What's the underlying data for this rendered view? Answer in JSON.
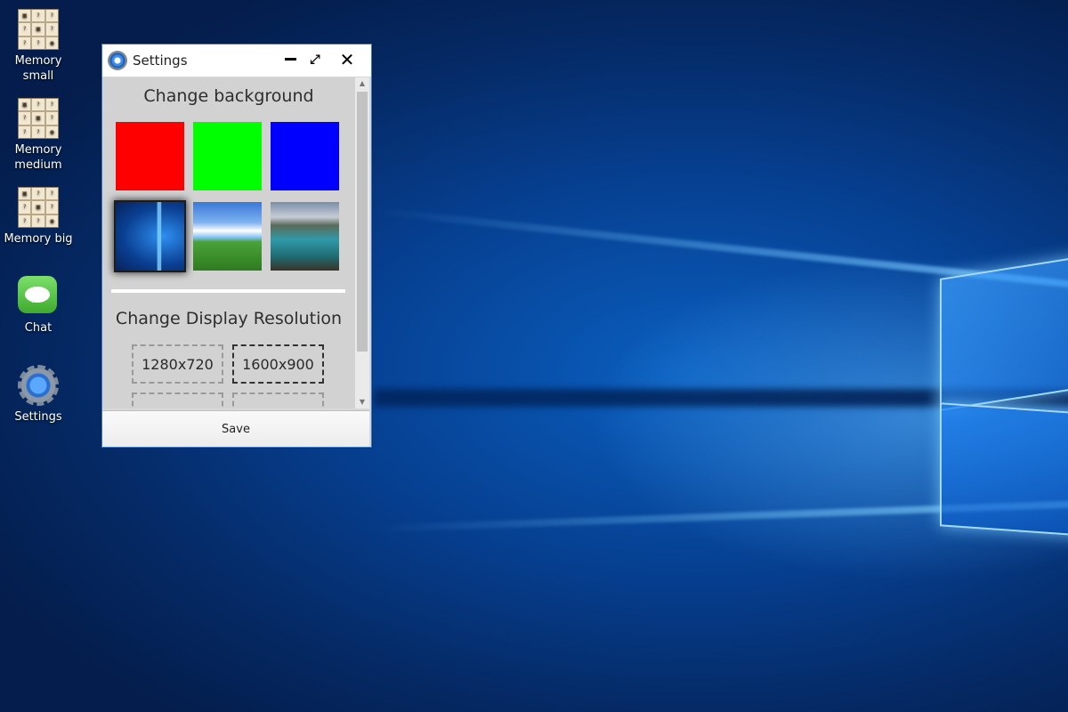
{
  "desktop": {
    "icons": [
      {
        "label": "Memory small",
        "icon": "memory-game-icon"
      },
      {
        "label": "Memory medium",
        "icon": "memory-game-icon"
      },
      {
        "label": "Memory big",
        "icon": "memory-game-icon"
      },
      {
        "label": "Chat",
        "icon": "chat-bubble-icon"
      },
      {
        "label": "Settings",
        "icon": "gear-icon"
      }
    ]
  },
  "window": {
    "title": "Settings",
    "buttons": {
      "minimize": "minimize-icon",
      "maximize": "maximize-icon",
      "close": "✕"
    },
    "background_section": {
      "title": "Change background",
      "options": [
        {
          "name": "red",
          "color": "#ff0000"
        },
        {
          "name": "green",
          "color": "#00ff00"
        },
        {
          "name": "blue",
          "color": "#0000ff"
        },
        {
          "name": "windows-10-wallpaper",
          "selected": true
        },
        {
          "name": "bliss-hill-wallpaper"
        },
        {
          "name": "mountain-lake-wallpaper"
        }
      ]
    },
    "resolution_section": {
      "title": "Change Display Resolution",
      "options": [
        {
          "label": "1280x720",
          "selected": false
        },
        {
          "label": "1600x900",
          "selected": true
        },
        {
          "label": "",
          "selected": false
        },
        {
          "label": "",
          "selected": false
        }
      ]
    },
    "save_label": "Save"
  }
}
